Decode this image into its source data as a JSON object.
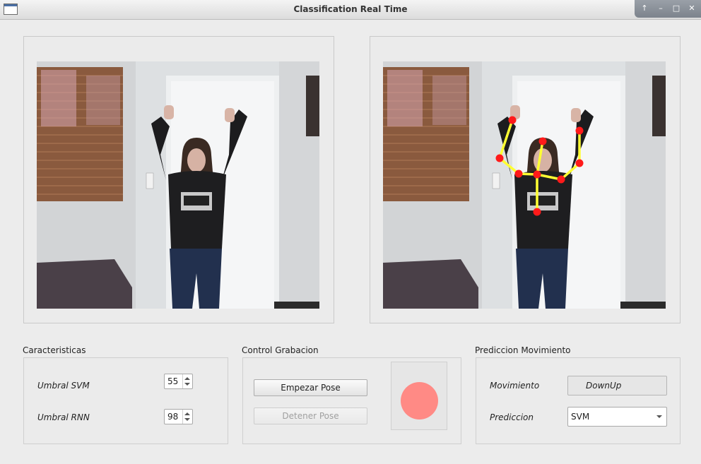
{
  "window": {
    "title": "Classification Real Time",
    "controls": {
      "up_icon": "arrow-up-icon",
      "minimize_icon": "minimize-icon",
      "maximize_icon": "maximize-icon",
      "close_icon": "close-icon"
    }
  },
  "caracteristicas": {
    "title": "Caracteristicas",
    "svm_label": "Umbral SVM",
    "svm_value": "55",
    "rnn_label": "Umbral RNN",
    "rnn_value": "98"
  },
  "control": {
    "title": "Control Grabacion",
    "start_label": "Empezar Pose",
    "stop_label": "Detener Pose",
    "indicator_color": "#ff8a85"
  },
  "prediccion": {
    "title": "Prediccion Movimiento",
    "movimiento_label": "Movimiento",
    "movimiento_value": "DownUp",
    "prediccion_label": "Prediccion",
    "prediccion_value": "SVM"
  },
  "skeleton": {
    "joint_color": "#ff1a1a",
    "bone_color": "#ffff33"
  }
}
